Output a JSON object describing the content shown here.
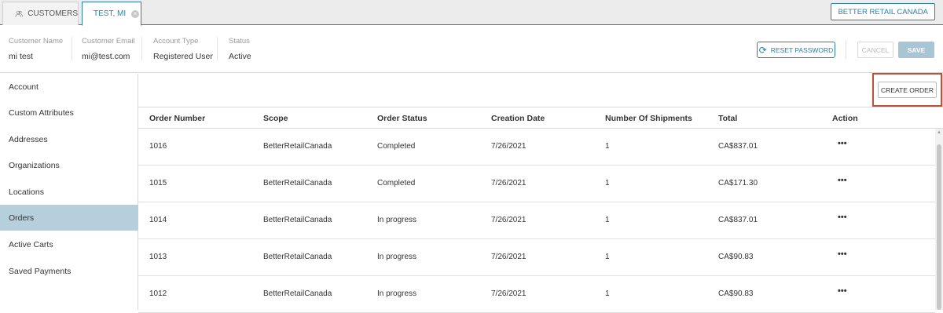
{
  "tabs": {
    "customers_label": "CUSTOMERS",
    "active_label": "TEST, MI",
    "close_glyph": "×",
    "store_label": "BETTER RETAIL CANADA"
  },
  "customer": {
    "name_label": "Customer Name",
    "name_value": "mi test",
    "email_label": "Customer Email",
    "email_value": "mi@test.com",
    "type_label": "Account Type",
    "type_value": "Registered User",
    "status_label": "Status",
    "status_value": "Active"
  },
  "actions": {
    "reset_password": "RESET PASSWORD",
    "cancel": "CANCEL",
    "save": "SAVE",
    "create_order": "CREATE ORDER"
  },
  "sidebar": {
    "items": [
      {
        "label": "Account"
      },
      {
        "label": "Custom Attributes"
      },
      {
        "label": "Addresses"
      },
      {
        "label": "Organizations"
      },
      {
        "label": "Locations"
      },
      {
        "label": "Orders"
      },
      {
        "label": "Active Carts"
      },
      {
        "label": "Saved Payments"
      }
    ],
    "active_item": "Orders"
  },
  "table": {
    "columns": [
      "Order Number",
      "Scope",
      "Order Status",
      "Creation Date",
      "Number Of Shipments",
      "Total",
      "Action"
    ],
    "rows": [
      {
        "order": "1016",
        "scope": "BetterRetailCanada",
        "status": "Completed",
        "date": "7/26/2021",
        "shipments": "1",
        "total": "CA$837.01",
        "action": "•••"
      },
      {
        "order": "1015",
        "scope": "BetterRetailCanada",
        "status": "Completed",
        "date": "7/26/2021",
        "shipments": "1",
        "total": "CA$171.30",
        "action": "•••"
      },
      {
        "order": "1014",
        "scope": "BetterRetailCanada",
        "status": "In progress",
        "date": "7/26/2021",
        "shipments": "1",
        "total": "CA$837.01",
        "action": "•••"
      },
      {
        "order": "1013",
        "scope": "BetterRetailCanada",
        "status": "In progress",
        "date": "7/26/2021",
        "shipments": "1",
        "total": "CA$90.83",
        "action": "•••"
      },
      {
        "order": "1012",
        "scope": "BetterRetailCanada",
        "status": "In progress",
        "date": "7/26/2021",
        "shipments": "1",
        "total": "CA$90.83",
        "action": "•••"
      }
    ]
  },
  "colors": {
    "accent": "#2f7ea3",
    "active_sidebar": "#b6cfdc",
    "highlight_frame": "#b9533c"
  },
  "icons": {
    "customers_tab": "users-icon",
    "close_tab": "close-icon",
    "reset_password": "refresh-icon",
    "row_action": "more-horizontal-icon"
  }
}
